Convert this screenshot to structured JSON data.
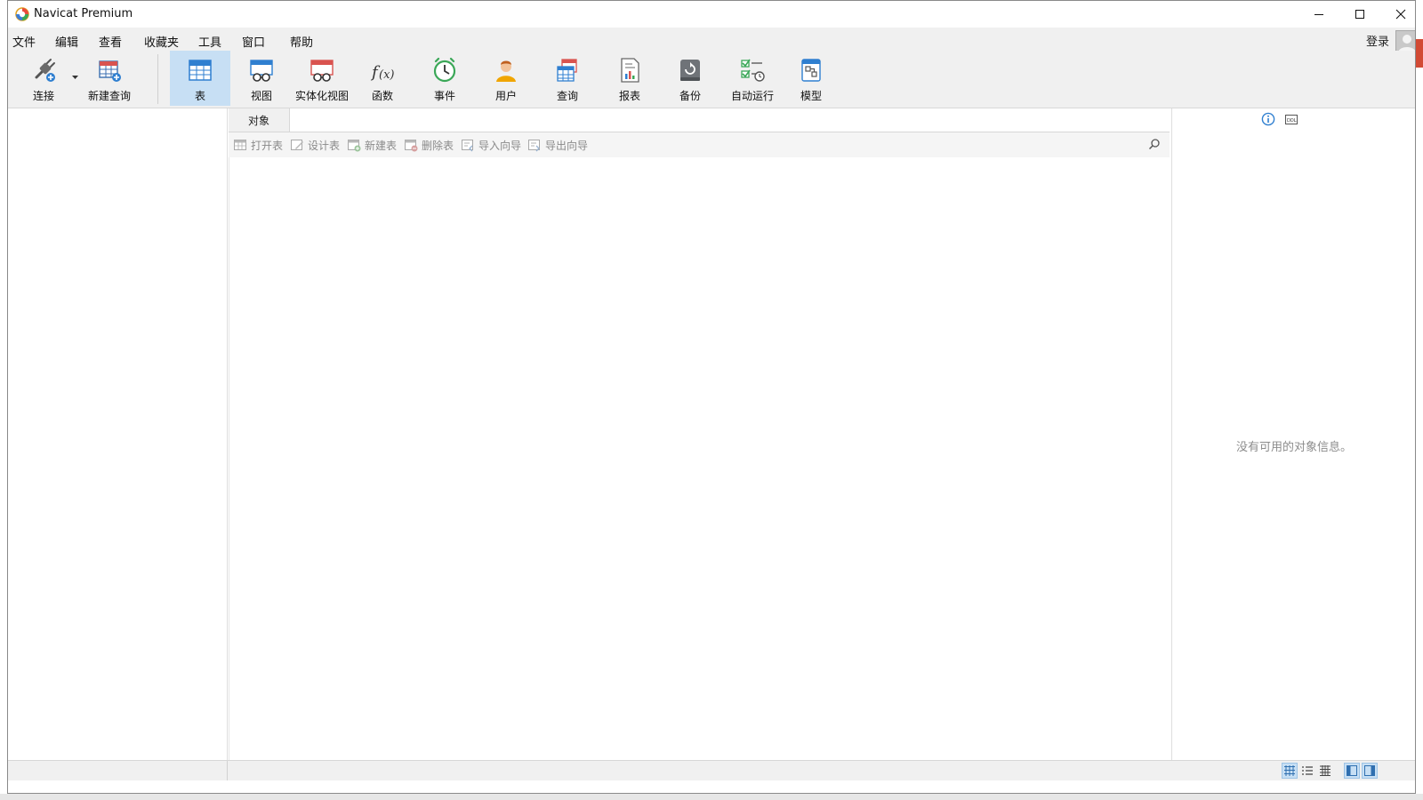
{
  "window": {
    "title": "Navicat Premium"
  },
  "menu": [
    "文件",
    "编辑",
    "查看",
    "收藏夹",
    "工具",
    "窗口",
    "帮助"
  ],
  "account": {
    "login_label": "登录"
  },
  "toolbar": {
    "connect": "连接",
    "new_query": "新建查询",
    "table": "表",
    "view": "视图",
    "materialized_view": "实体化视图",
    "function": "函数",
    "event": "事件",
    "user": "用户",
    "query": "查询",
    "report": "报表",
    "backup": "备份",
    "automation": "自动运行",
    "model": "模型",
    "active": "表"
  },
  "objects_tab": {
    "label": "对象"
  },
  "object_toolbar": {
    "open_table": "打开表",
    "design_table": "设计表",
    "new_table": "新建表",
    "delete_table": "删除表",
    "import_wizard": "导入向导",
    "export_wizard": "导出向导"
  },
  "info_panel": {
    "empty_message": "没有可用的对象信息。"
  },
  "colors": {
    "active_tab": "#c7dff4",
    "chrome": "#f0f0f0",
    "accent_blue": "#2f7fd0"
  }
}
